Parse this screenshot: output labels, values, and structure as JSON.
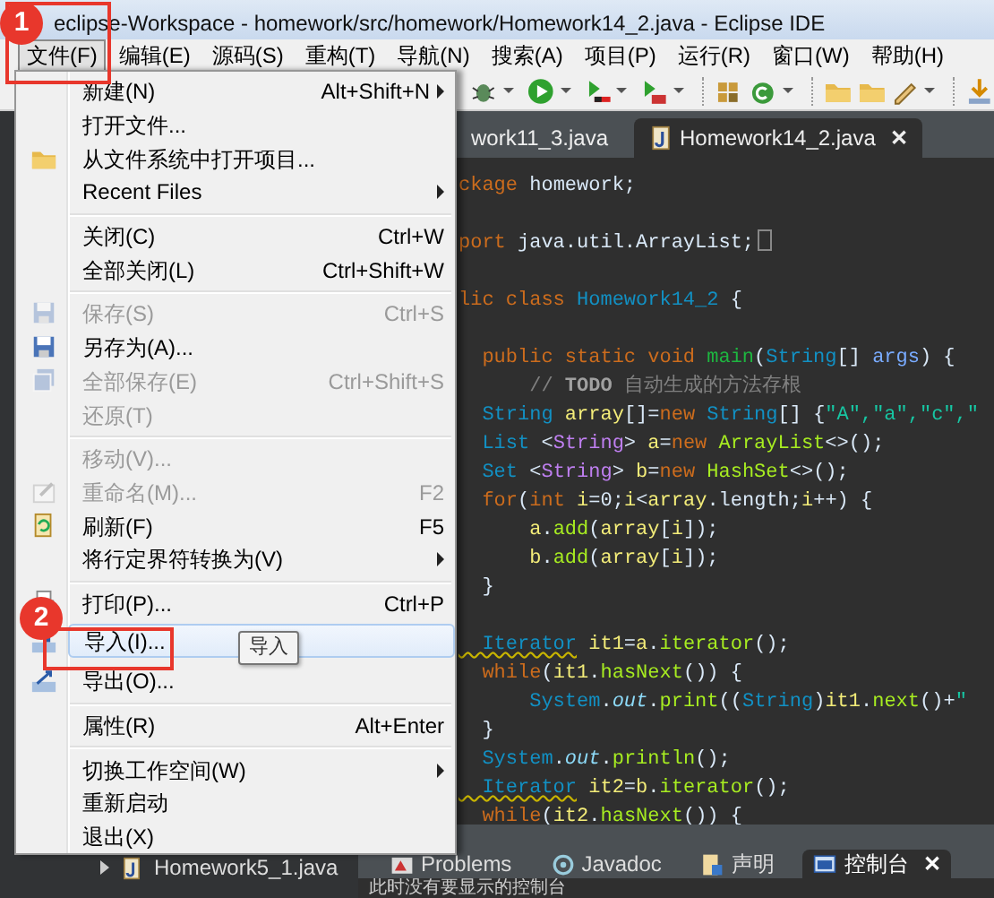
{
  "window": {
    "title": "eclipse-Workspace - homework/src/homework/Homework14_2.java - Eclipse IDE"
  },
  "menu_bar": [
    {
      "label": "文件(F)",
      "selected": true
    },
    {
      "label": "编辑(E)",
      "selected": false
    },
    {
      "label": "源码(S)",
      "selected": false
    },
    {
      "label": "重构(T)",
      "selected": false
    },
    {
      "label": "导航(N)",
      "selected": false
    },
    {
      "label": "搜索(A)",
      "selected": false
    },
    {
      "label": "项目(P)",
      "selected": false
    },
    {
      "label": "运行(R)",
      "selected": false
    },
    {
      "label": "窗口(W)",
      "selected": false
    },
    {
      "label": "帮助(H)",
      "selected": false
    }
  ],
  "editor_tabs": [
    {
      "label": "work11_3.java",
      "selected": false
    },
    {
      "label": "Homework14_2.java",
      "selected": true,
      "close": "✕"
    }
  ],
  "code_lines": [
    {
      "kind": "code",
      "segments": [
        {
          "text": "ckage",
          "kind": "kw"
        },
        {
          "text": " homework;",
          "kind": "plain"
        }
      ]
    },
    {
      "kind": "blank"
    },
    {
      "kind": "code",
      "folded": true,
      "segments": [
        {
          "text": "port",
          "kind": "kw"
        },
        {
          "text": " java.util.ArrayList;",
          "kind": "plain"
        }
      ]
    },
    {
      "kind": "blank"
    },
    {
      "kind": "code",
      "segments": [
        {
          "text": "lic class ",
          "kind": "kw"
        },
        {
          "text": "Homework14_2",
          "kind": "cls"
        },
        {
          "text": " {",
          "kind": "plain"
        }
      ]
    },
    {
      "kind": "blank"
    },
    {
      "kind": "code",
      "segments": [
        {
          "text": "  public static void ",
          "kind": "kw"
        },
        {
          "text": "main",
          "kind": "decl"
        },
        {
          "text": "(",
          "kind": "plain"
        },
        {
          "text": "String",
          "kind": "type"
        },
        {
          "text": "[] ",
          "kind": "plain"
        },
        {
          "text": "args",
          "kind": "param"
        },
        {
          "text": ") {",
          "kind": "plain"
        }
      ]
    },
    {
      "kind": "code",
      "segments": [
        {
          "text": "      // ",
          "kind": "cmt"
        },
        {
          "text": "TODO",
          "kind": "todo"
        },
        {
          "text": " 自动生成的方法存根",
          "kind": "cmt"
        }
      ]
    },
    {
      "kind": "code",
      "segments": [
        {
          "text": "  String ",
          "kind": "type"
        },
        {
          "text": "array",
          "kind": "var"
        },
        {
          "text": "[]=",
          "kind": "plain"
        },
        {
          "text": "new ",
          "kind": "kw"
        },
        {
          "text": "String",
          "kind": "type"
        },
        {
          "text": "[] {",
          "kind": "plain"
        },
        {
          "text": "\"A\",\"a\",\"c\",\"",
          "kind": "str"
        }
      ]
    },
    {
      "kind": "code",
      "segments": [
        {
          "text": "  List",
          "kind": "type"
        },
        {
          "text": " <",
          "kind": "plain"
        },
        {
          "text": "String",
          "kind": "generic"
        },
        {
          "text": "> ",
          "kind": "plain"
        },
        {
          "text": "a",
          "kind": "var"
        },
        {
          "text": "=",
          "kind": "plain"
        },
        {
          "text": "new ",
          "kind": "kw"
        },
        {
          "text": "ArrayList",
          "kind": "fn"
        },
        {
          "text": "<>();",
          "kind": "plain"
        }
      ]
    },
    {
      "kind": "code",
      "segments": [
        {
          "text": "  Set",
          "kind": "type"
        },
        {
          "text": " <",
          "kind": "plain"
        },
        {
          "text": "String",
          "kind": "generic"
        },
        {
          "text": "> ",
          "kind": "plain"
        },
        {
          "text": "b",
          "kind": "var"
        },
        {
          "text": "=",
          "kind": "plain"
        },
        {
          "text": "new ",
          "kind": "kw"
        },
        {
          "text": "HashSet",
          "kind": "fn"
        },
        {
          "text": "<>();",
          "kind": "plain"
        }
      ]
    },
    {
      "kind": "code",
      "segments": [
        {
          "text": "  for",
          "kind": "kw"
        },
        {
          "text": "(",
          "kind": "plain"
        },
        {
          "text": "int ",
          "kind": "kw"
        },
        {
          "text": "i",
          "kind": "var"
        },
        {
          "text": "=0;",
          "kind": "plain"
        },
        {
          "text": "i",
          "kind": "var"
        },
        {
          "text": "<",
          "kind": "plain"
        },
        {
          "text": "array",
          "kind": "var"
        },
        {
          "text": ".length;",
          "kind": "plain"
        },
        {
          "text": "i",
          "kind": "var"
        },
        {
          "text": "++) {",
          "kind": "plain"
        }
      ]
    },
    {
      "kind": "code",
      "segments": [
        {
          "text": "      a",
          "kind": "var"
        },
        {
          "text": ".",
          "kind": "plain"
        },
        {
          "text": "add",
          "kind": "fn"
        },
        {
          "text": "(",
          "kind": "plain"
        },
        {
          "text": "array",
          "kind": "var"
        },
        {
          "text": "[",
          "kind": "plain"
        },
        {
          "text": "i",
          "kind": "var"
        },
        {
          "text": "]);",
          "kind": "plain"
        }
      ]
    },
    {
      "kind": "code",
      "segments": [
        {
          "text": "      b",
          "kind": "var"
        },
        {
          "text": ".",
          "kind": "plain"
        },
        {
          "text": "add",
          "kind": "fn"
        },
        {
          "text": "(",
          "kind": "plain"
        },
        {
          "text": "array",
          "kind": "var"
        },
        {
          "text": "[",
          "kind": "plain"
        },
        {
          "text": "i",
          "kind": "var"
        },
        {
          "text": "]);",
          "kind": "plain"
        }
      ]
    },
    {
      "kind": "code",
      "segments": [
        {
          "text": "  }",
          "kind": "plain"
        }
      ]
    },
    {
      "kind": "blank"
    },
    {
      "kind": "code",
      "segments": [
        {
          "text": "  Iterator",
          "kind": "warn"
        },
        {
          "text": " it1",
          "kind": "var"
        },
        {
          "text": "=",
          "kind": "plain"
        },
        {
          "text": "a",
          "kind": "var"
        },
        {
          "text": ".",
          "kind": "plain"
        },
        {
          "text": "iterator",
          "kind": "fn"
        },
        {
          "text": "();",
          "kind": "plain"
        }
      ]
    },
    {
      "kind": "code",
      "segments": [
        {
          "text": "  while",
          "kind": "kw"
        },
        {
          "text": "(",
          "kind": "plain"
        },
        {
          "text": "it1",
          "kind": "var"
        },
        {
          "text": ".",
          "kind": "plain"
        },
        {
          "text": "hasNext",
          "kind": "fn"
        },
        {
          "text": "()) {",
          "kind": "plain"
        }
      ]
    },
    {
      "kind": "code",
      "segments": [
        {
          "text": "      System",
          "kind": "type"
        },
        {
          "text": ".",
          "kind": "plain"
        },
        {
          "text": "out",
          "kind": "field"
        },
        {
          "text": ".",
          "kind": "plain"
        },
        {
          "text": "print",
          "kind": "fn"
        },
        {
          "text": "((",
          "kind": "plain"
        },
        {
          "text": "String",
          "kind": "type"
        },
        {
          "text": ")",
          "kind": "plain"
        },
        {
          "text": "it1",
          "kind": "var"
        },
        {
          "text": ".",
          "kind": "plain"
        },
        {
          "text": "next",
          "kind": "fn"
        },
        {
          "text": "()+",
          "kind": "plain"
        },
        {
          "text": "\"",
          "kind": "str"
        }
      ]
    },
    {
      "kind": "code",
      "segments": [
        {
          "text": "  }",
          "kind": "plain"
        }
      ]
    },
    {
      "kind": "code",
      "segments": [
        {
          "text": "  System",
          "kind": "type"
        },
        {
          "text": ".",
          "kind": "plain"
        },
        {
          "text": "out",
          "kind": "field"
        },
        {
          "text": ".",
          "kind": "plain"
        },
        {
          "text": "println",
          "kind": "fn"
        },
        {
          "text": "();",
          "kind": "plain"
        }
      ]
    },
    {
      "kind": "code",
      "segments": [
        {
          "text": "  Iterator",
          "kind": "warn"
        },
        {
          "text": " it2",
          "kind": "var"
        },
        {
          "text": "=",
          "kind": "plain"
        },
        {
          "text": "b",
          "kind": "var"
        },
        {
          "text": ".",
          "kind": "plain"
        },
        {
          "text": "iterator",
          "kind": "fn"
        },
        {
          "text": "();",
          "kind": "plain"
        }
      ]
    },
    {
      "kind": "code",
      "segments": [
        {
          "text": "  while",
          "kind": "kw"
        },
        {
          "text": "(",
          "kind": "plain"
        },
        {
          "text": "it2",
          "kind": "var"
        },
        {
          "text": ".",
          "kind": "plain"
        },
        {
          "text": "hasNext",
          "kind": "fn"
        },
        {
          "text": "()) {",
          "kind": "plain"
        }
      ]
    }
  ],
  "explorer": {
    "items": [
      {
        "label": "Homework5_1.java",
        "expanded": false
      }
    ]
  },
  "bottom_tabs": [
    {
      "label": "Problems",
      "selected": false
    },
    {
      "label": "Javadoc",
      "selected": false
    },
    {
      "label": "声明",
      "selected": false
    },
    {
      "label": "控制台",
      "selected": true,
      "close": "✕"
    }
  ],
  "console": {
    "message": "此时没有要显示的控制台"
  },
  "file_menu": {
    "items": [
      {
        "kind": "item",
        "label": "新建(N)",
        "shortcut": "Alt+Shift+N",
        "submenu": true,
        "disabled": false,
        "highlighted": false
      },
      {
        "kind": "item",
        "label": "打开文件...",
        "submenu": false,
        "disabled": false,
        "highlighted": false
      },
      {
        "kind": "item",
        "label": "从文件系统中打开项目...",
        "submenu": false,
        "disabled": false,
        "highlighted": false
      },
      {
        "kind": "item",
        "label": "Recent Files",
        "submenu": true,
        "disabled": false,
        "highlighted": false
      },
      {
        "kind": "separator"
      },
      {
        "kind": "item",
        "label": "关闭(C)",
        "shortcut": "Ctrl+W",
        "submenu": false,
        "disabled": false,
        "highlighted": false
      },
      {
        "kind": "item",
        "label": "全部关闭(L)",
        "shortcut": "Ctrl+Shift+W",
        "submenu": false,
        "disabled": false,
        "highlighted": false
      },
      {
        "kind": "separator"
      },
      {
        "kind": "item",
        "label": "保存(S)",
        "shortcut": "Ctrl+S",
        "submenu": false,
        "disabled": true,
        "highlighted": false
      },
      {
        "kind": "item",
        "label": "另存为(A)...",
        "submenu": false,
        "disabled": false,
        "highlighted": false
      },
      {
        "kind": "item",
        "label": "全部保存(E)",
        "shortcut": "Ctrl+Shift+S",
        "submenu": false,
        "disabled": true,
        "highlighted": false
      },
      {
        "kind": "item",
        "label": "还原(T)",
        "submenu": false,
        "disabled": true,
        "highlighted": false
      },
      {
        "kind": "separator"
      },
      {
        "kind": "item",
        "label": "移动(V)...",
        "submenu": false,
        "disabled": true,
        "highlighted": false
      },
      {
        "kind": "item",
        "label": "重命名(M)...",
        "shortcut": "F2",
        "submenu": false,
        "disabled": true,
        "highlighted": false
      },
      {
        "kind": "item",
        "label": "刷新(F)",
        "shortcut": "F5",
        "submenu": false,
        "disabled": false,
        "highlighted": false
      },
      {
        "kind": "item",
        "label": "将行定界符转换为(V)",
        "submenu": true,
        "disabled": false,
        "highlighted": false
      },
      {
        "kind": "separator"
      },
      {
        "kind": "item",
        "label": "打印(P)...",
        "shortcut": "Ctrl+P",
        "submenu": false,
        "disabled": false,
        "highlighted": false
      },
      {
        "kind": "item",
        "label": "导入(I)...",
        "submenu": false,
        "disabled": false,
        "highlighted": true
      },
      {
        "kind": "item",
        "label": "导出(O)...",
        "submenu": false,
        "disabled": false,
        "highlighted": false
      },
      {
        "kind": "separator"
      },
      {
        "kind": "item",
        "label": "属性(R)",
        "shortcut": "Alt+Enter",
        "submenu": false,
        "disabled": false,
        "highlighted": false
      },
      {
        "kind": "separator"
      },
      {
        "kind": "item",
        "label": "切换工作空间(W)",
        "submenu": true,
        "disabled": false,
        "highlighted": false
      },
      {
        "kind": "item",
        "label": "重新启动",
        "submenu": false,
        "disabled": false,
        "highlighted": false
      },
      {
        "kind": "item",
        "label": "退出(X)",
        "submenu": false,
        "disabled": false,
        "highlighted": false
      }
    ]
  },
  "tooltip": {
    "text": "导入"
  },
  "annotations": [
    {
      "label": "1"
    },
    {
      "label": "2"
    }
  ]
}
